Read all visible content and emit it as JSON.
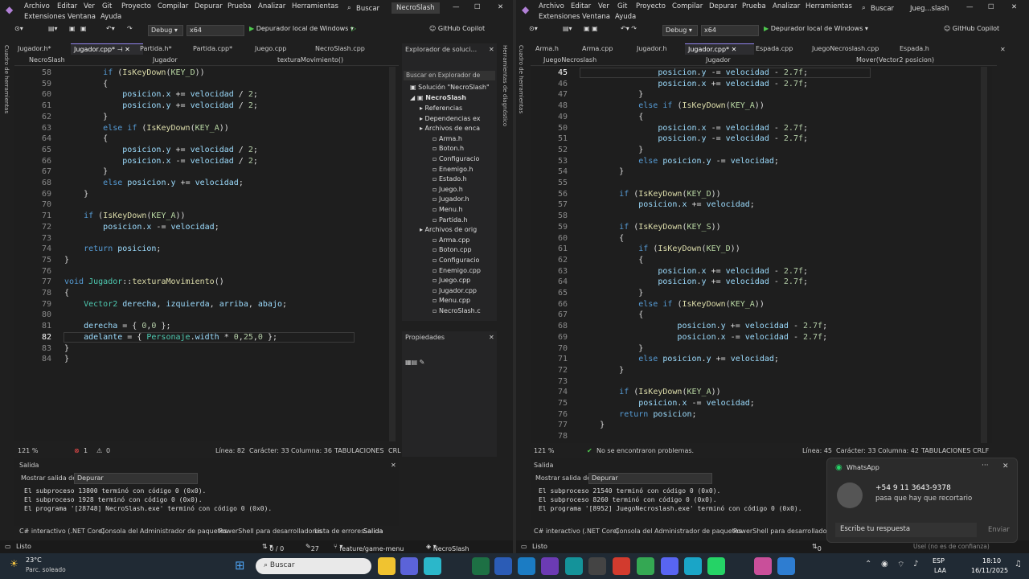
{
  "colors": {
    "accent": "#9184ee",
    "keyword": "#569cd6",
    "func": "#dcdcaa",
    "var": "#9cdcfe",
    "num": "#b5cea8",
    "type": "#4ec9b0",
    "text": "#dcdcdc"
  },
  "left": {
    "menu": [
      "Archivo",
      "Editar",
      "Ver",
      "Git",
      "Proyecto",
      "Compilar",
      "Depurar",
      "Prueba",
      "Analizar",
      "Herramientas",
      "Extensiones",
      "Ventana",
      "Ayuda"
    ],
    "search": "Buscar",
    "title": "NecroSlash",
    "toolbar": {
      "config": "Debug",
      "platform": "x64",
      "run": "Depurador local de Windows",
      "copilot": "GitHub Copilot"
    },
    "tabs": [
      "Jugador.h*",
      "Jugador.cpp*",
      "Partida.h*",
      "Partida.cpp*",
      "Juego.cpp",
      "NecroSlash.cpp"
    ],
    "nav": {
      "project": "NecroSlash",
      "scope": "Jugador",
      "member": "texturaMovimiento()"
    },
    "side_label": "Cuadro de herramientas",
    "lines": [
      {
        "n": "58",
        "t": "        if (IsKeyDown(KEY_D))"
      },
      {
        "n": "59",
        "t": "        {"
      },
      {
        "n": "60",
        "t": "            posicion.x += velocidad / 2;"
      },
      {
        "n": "61",
        "t": "            posicion.y += velocidad / 2;"
      },
      {
        "n": "62",
        "t": "        }"
      },
      {
        "n": "63",
        "t": "        else if (IsKeyDown(KEY_A))"
      },
      {
        "n": "64",
        "t": "        {"
      },
      {
        "n": "65",
        "t": "            posicion.y += velocidad / 2;"
      },
      {
        "n": "66",
        "t": "            posicion.x -= velocidad / 2;"
      },
      {
        "n": "67",
        "t": "        }"
      },
      {
        "n": "68",
        "t": "        else posicion.y += velocidad;"
      },
      {
        "n": "69",
        "t": "    }"
      },
      {
        "n": "70",
        "t": ""
      },
      {
        "n": "71",
        "t": "    if (IsKeyDown(KEY_A))"
      },
      {
        "n": "72",
        "t": "        posicion.x -= velocidad;"
      },
      {
        "n": "73",
        "t": ""
      },
      {
        "n": "74",
        "t": "    return posicion;"
      },
      {
        "n": "75",
        "t": "}"
      },
      {
        "n": "76",
        "t": ""
      },
      {
        "n": "77",
        "t": "void Jugador::texturaMovimiento()"
      },
      {
        "n": "78",
        "t": "{"
      },
      {
        "n": "79",
        "t": "    Vector2 derecha, izquierda, arriba, abajo;"
      },
      {
        "n": "80",
        "t": ""
      },
      {
        "n": "81",
        "t": "    derecha = { 0,0 };"
      },
      {
        "n": "82",
        "t": "    adelante = { Personaje.width * 0,25,0 };"
      },
      {
        "n": "83",
        "t": "}"
      },
      {
        "n": "84",
        "t": "}"
      }
    ],
    "status": {
      "zoom": "121 %",
      "errors": "1",
      "warnings": "0",
      "line": "Línea: 82",
      "char": "Carácter: 33",
      "col": "Columna: 36",
      "tabs": "TABULACIONES",
      "eol": "CRL"
    },
    "explorer": {
      "title": "Explorador de soluci...",
      "search": "Buscar en Explorador de",
      "solution": "Solución \"NecroSlash\"",
      "project": "NecroSlash",
      "items": [
        "Referencias",
        "Dependencias ex",
        "Archivos de enca",
        "Arma.h",
        "Boton.h",
        "Configuracio",
        "Enemigo.h",
        "Estado.h",
        "Juego.h",
        "Jugador.h",
        "Menu.h",
        "Partida.h",
        "Archivos de orig",
        "Arma.cpp",
        "Boton.cpp",
        "Configuracio",
        "Enemigo.cpp",
        "Juego.cpp",
        "Jugador.cpp",
        "Menu.cpp",
        "NecroSlash.c"
      ]
    },
    "props_title": "Propiedades",
    "diag_label": "Herramientas de diagnóstico",
    "output": {
      "title": "Salida",
      "show_from": "Mostrar salida de:",
      "source": "Depurar",
      "lines": [
        "El subproceso 13800 terminó con código 0 (0x0).",
        "El subproceso 1928 terminó con código 0 (0x0).",
        "El programa '[28748] NecroSlash.exe' terminó con código 0 (0x0)."
      ]
    },
    "bottom_tabs": [
      "C# interactivo (.NET Core)",
      "Consola del Administrador de paquetes",
      "PowerShell para desarrolladores",
      "Lista de errores",
      "Salida"
    ],
    "statusbar": {
      "ready": "Listo",
      "sync": "0 / 0",
      "edits": "27",
      "branch": "feature/game-menu",
      "repo": "NecroSlash"
    }
  },
  "right": {
    "menu": [
      "Archivo",
      "Editar",
      "Ver",
      "Git",
      "Proyecto",
      "Compilar",
      "Depurar",
      "Prueba",
      "Analizar",
      "Herramientas",
      "Extensiones",
      "Ventana",
      "Ayuda"
    ],
    "search": "Buscar",
    "title": "Jueg...slash",
    "toolbar": {
      "config": "Debug",
      "platform": "x64",
      "run": "Depurador local de Windows",
      "copilot": "GitHub Copilot"
    },
    "tabs": [
      "Arma.h",
      "Arma.cpp",
      "Jugador.h",
      "Jugador.cpp*",
      "Espada.cpp",
      "JuegoNecroslash.cpp",
      "Espada.h"
    ],
    "nav": {
      "project": "JuegoNecroslash",
      "scope": "Jugador",
      "member": "Mover(Vector2 posicion)"
    },
    "lines": [
      {
        "n": "45",
        "t": "                posicion.y -= velocidad - 2.7f;"
      },
      {
        "n": "46",
        "t": "                posicion.x += velocidad - 2.7f;"
      },
      {
        "n": "47",
        "t": "            }"
      },
      {
        "n": "48",
        "t": "            else if (IsKeyDown(KEY_A))"
      },
      {
        "n": "49",
        "t": "            {"
      },
      {
        "n": "50",
        "t": "                posicion.x -= velocidad - 2.7f;"
      },
      {
        "n": "51",
        "t": "                posicion.y -= velocidad - 2.7f;"
      },
      {
        "n": "52",
        "t": "            }"
      },
      {
        "n": "53",
        "t": "            else posicion.y -= velocidad;"
      },
      {
        "n": "54",
        "t": "        }"
      },
      {
        "n": "55",
        "t": ""
      },
      {
        "n": "56",
        "t": "        if (IsKeyDown(KEY_D))"
      },
      {
        "n": "57",
        "t": "            posicion.x += velocidad;"
      },
      {
        "n": "58",
        "t": ""
      },
      {
        "n": "59",
        "t": "        if (IsKeyDown(KEY_S))"
      },
      {
        "n": "60",
        "t": "        {"
      },
      {
        "n": "61",
        "t": "            if (IsKeyDown(KEY_D))"
      },
      {
        "n": "62",
        "t": "            {"
      },
      {
        "n": "63",
        "t": "                posicion.x += velocidad - 2.7f;"
      },
      {
        "n": "64",
        "t": "                posicion.y += velocidad - 2.7f;"
      },
      {
        "n": "65",
        "t": "            }"
      },
      {
        "n": "66",
        "t": "            else if (IsKeyDown(KEY_A))"
      },
      {
        "n": "67",
        "t": "            {"
      },
      {
        "n": "68",
        "t": "                    posicion.y += velocidad - 2.7f;"
      },
      {
        "n": "69",
        "t": "                    posicion.x -= velocidad - 2.7f;"
      },
      {
        "n": "70",
        "t": "            }"
      },
      {
        "n": "71",
        "t": "            else posicion.y += velocidad;"
      },
      {
        "n": "72",
        "t": "        }"
      },
      {
        "n": "73",
        "t": ""
      },
      {
        "n": "74",
        "t": "        if (IsKeyDown(KEY_A))"
      },
      {
        "n": "75",
        "t": "            posicion.x -= velocidad;"
      },
      {
        "n": "76",
        "t": "        return posicion;"
      },
      {
        "n": "77",
        "t": "    }"
      },
      {
        "n": "78",
        "t": ""
      }
    ],
    "status": {
      "zoom": "121 %",
      "problems": "No se encontraron problemas.",
      "line": "Línea: 45",
      "char": "Carácter: 33",
      "col": "Columna: 42",
      "tabs": "TABULACIONES",
      "eol": "CRLF"
    },
    "output": {
      "title": "Salida",
      "show_from": "Mostrar salida de:",
      "source": "Depurar",
      "lines": [
        "El subproceso 21540 terminó con código 0 (0x0).",
        "El subproceso 8260 terminó con código 0 (0x0).",
        "El programa '[8952] JuegoNecroslash.exe' terminó con código 0 (0x0)."
      ]
    },
    "bottom_tabs": [
      "C# interactivo (.NET Core)",
      "Consola del Administrador de paquetes",
      "PowerShell para desarrolladores"
    ],
    "statusbar": {
      "ready": "Listo",
      "sync": "0"
    },
    "side_label": "Cuadro de herramientas"
  },
  "whatsapp": {
    "app": "WhatsApp",
    "phone": "+54 9 11 3643-9378",
    "message": "pasa que hay que recortario",
    "placeholder": "Escribe tu respuesta",
    "send": "Enviar"
  },
  "taskbar": {
    "weather_temp": "23°C",
    "weather_desc": "Parc. soleado",
    "search": "Buscar",
    "lang": "ESP",
    "region": "LAA",
    "time": "18:10",
    "date": "16/11/2025",
    "user_hint": "Usel (no es de confianza)"
  }
}
